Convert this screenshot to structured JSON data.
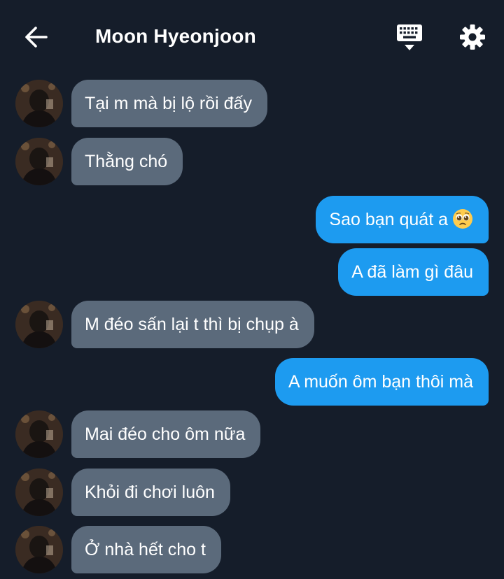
{
  "header": {
    "title": "Moon Hyeonjoon",
    "back_icon": "arrow-left-icon",
    "keyboard_icon": "keyboard-icon",
    "settings_icon": "gear-icon"
  },
  "colors": {
    "background": "#151d2a",
    "incoming_bubble": "#5b6a7b",
    "outgoing_bubble": "#1d9bf0",
    "text": "#ffffff"
  },
  "messages": [
    {
      "side": "in",
      "text": "Tại m mà bị lộ rồi đấy"
    },
    {
      "side": "in",
      "text": "Thằng chó"
    },
    {
      "side": "out",
      "text": "Sao bạn quát a",
      "emoji": "pleading-face-emoji"
    },
    {
      "side": "out",
      "text": "A đã làm gì đâu"
    },
    {
      "side": "in",
      "text": "M đéo sấn lại t thì bị chụp à"
    },
    {
      "side": "out",
      "text": "A muốn ôm bạn thôi mà"
    },
    {
      "side": "in",
      "text": "Mai đéo cho ôm nữa"
    },
    {
      "side": "in",
      "text": "Khỏi đi chơi luôn"
    },
    {
      "side": "in",
      "text": "Ở nhà hết cho t"
    }
  ]
}
